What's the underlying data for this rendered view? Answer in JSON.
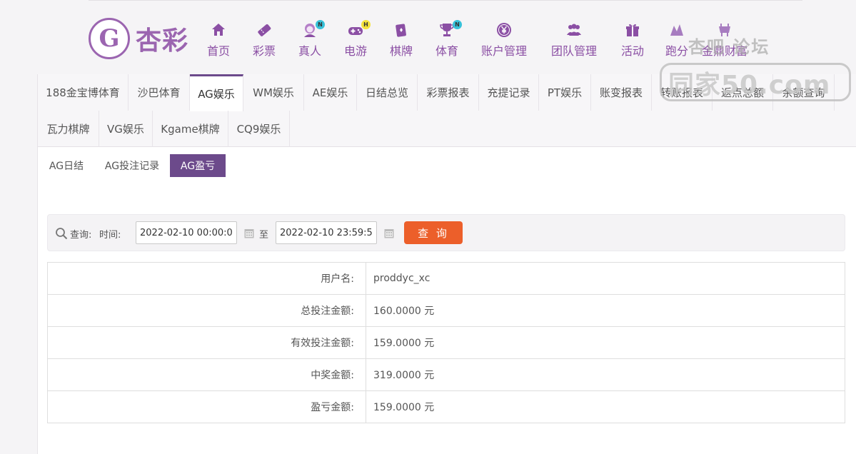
{
  "brand": {
    "name": "杏彩",
    "mark": "G"
  },
  "nav": [
    {
      "label": "首页",
      "icon": "home-icon",
      "badge": ""
    },
    {
      "label": "彩票",
      "icon": "lottery-ticket-icon",
      "badge": ""
    },
    {
      "label": "真人",
      "icon": "live-dealer-icon",
      "badge": "N"
    },
    {
      "label": "电游",
      "icon": "gamepad-icon",
      "badge": "H"
    },
    {
      "label": "棋牌",
      "icon": "cards-icon",
      "badge": ""
    },
    {
      "label": "体育",
      "icon": "trophy-icon",
      "badge": "N"
    },
    {
      "label": "账户管理",
      "icon": "yen-coin-icon",
      "badge": ""
    },
    {
      "label": "团队管理",
      "icon": "team-icon",
      "badge": ""
    },
    {
      "label": "活动",
      "icon": "gift-icon",
      "badge": ""
    },
    {
      "label": "跑分",
      "icon": "run-icon",
      "badge": ""
    },
    {
      "label": "金鼎财富",
      "icon": "cauldron-icon",
      "badge": ""
    }
  ],
  "watermark": {
    "top": "杏吧 论坛",
    "url": "同家50.com"
  },
  "tabs_row1": [
    "188金宝博体育",
    "沙巴体育",
    "AG娱乐",
    "WM娱乐",
    "AE娱乐",
    "日结总览",
    "彩票报表",
    "充提记录",
    "PT娱乐",
    "账变报表",
    "转账报表",
    "返点总额",
    "余额查询"
  ],
  "tabs_row2": [
    "瓦力棋牌",
    "VG娱乐",
    "Kgame棋牌",
    "CQ9娱乐"
  ],
  "active_tab": "AG娱乐",
  "sub_tabs": [
    "AG日结",
    "AG投注记录",
    "AG盈亏"
  ],
  "active_sub_tab": "AG盈亏",
  "query": {
    "query_label": "查询:",
    "time_label": "时间:",
    "start": "2022-02-10 00:00:00",
    "to_label": "至",
    "end": "2022-02-10 23:59:59",
    "button": "查 询"
  },
  "result": [
    {
      "key": "用户名:",
      "value": "proddyc_xc"
    },
    {
      "key": "总投注金额:",
      "value": "160.0000 元"
    },
    {
      "key": "有效投注金额:",
      "value": "159.0000 元"
    },
    {
      "key": "中奖金额:",
      "value": "319.0000 元"
    },
    {
      "key": "盈亏金额:",
      "value": "159.0000 元"
    }
  ],
  "colors": {
    "brand": "#8b4fa4",
    "active_tab": "#6c4a8b",
    "query_button": "#ec5f2a"
  }
}
